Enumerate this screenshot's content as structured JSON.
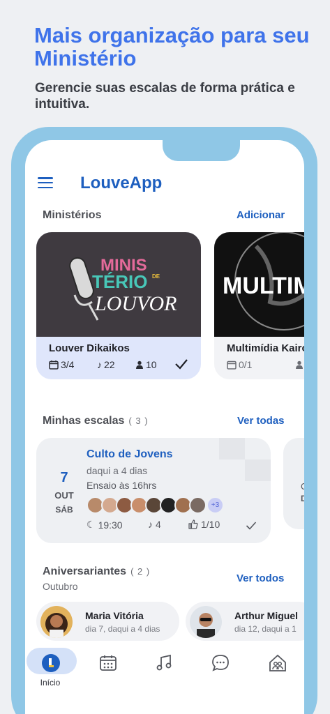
{
  "promo": {
    "headline": "Mais organização para seu Ministério",
    "subline": "Gerencie suas escalas de forma prática e intuitiva."
  },
  "header": {
    "app_title": "LouveApp"
  },
  "ministries": {
    "title": "Ministérios",
    "add_label": "Adicionar",
    "cards": [
      {
        "name": "Louver Dikaikos",
        "schedules": "3/4",
        "songs": "22",
        "members": "10",
        "image_text": [
          "MINIS",
          "TÉRIO",
          "DE",
          "LOUVOR"
        ]
      },
      {
        "name": "Multimídia Kairós",
        "schedules": "0/1",
        "members": "",
        "image_text": "MULTIM"
      }
    ]
  },
  "schedules": {
    "title": "Minhas escalas",
    "count": "( 3 )",
    "view_all": "Ver todas",
    "event": {
      "day": "7",
      "month": "OUT",
      "weekday": "SÁB",
      "title": "Culto de Jovens",
      "relative": "daqui a 4 dias",
      "rehearsal": "Ensaio às 16hrs",
      "more_members": "+3",
      "time": "19:30",
      "songs": "4",
      "confirmed": "1/10"
    },
    "peek_letters": [
      "C",
      "D"
    ]
  },
  "birthdays": {
    "title": "Aniversariantes",
    "count": "( 2 )",
    "month": "Outubro",
    "view_all": "Ver todos",
    "people": [
      {
        "name": "Maria Vitória",
        "date": "dia 7, daqui a 4 dias"
      },
      {
        "name": "Arthur Miguel",
        "date": "dia 12, daqui a 1"
      }
    ]
  },
  "nav": {
    "items": [
      {
        "label": "Início",
        "icon": "home-logo-icon",
        "active": true
      },
      {
        "label": "",
        "icon": "calendar-icon"
      },
      {
        "label": "",
        "icon": "music-notes-icon"
      },
      {
        "label": "",
        "icon": "chat-bubble-icon"
      },
      {
        "label": "",
        "icon": "group-house-icon"
      }
    ]
  },
  "colors": {
    "accent": "#1e5fbf",
    "headline": "#3f73ea",
    "frame": "#8fc7e6",
    "selected_card": "#dfe6fb"
  }
}
